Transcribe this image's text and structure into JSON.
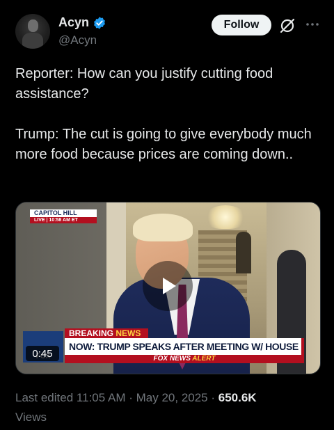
{
  "author": {
    "display_name": "Acyn",
    "handle": "@Acyn",
    "verified": true,
    "verified_color": "#1d9bf0"
  },
  "actions": {
    "follow_label": "Follow",
    "grok_icon": "grok-icon",
    "more_icon": "more-icon"
  },
  "tweet": {
    "text": "Reporter: How can you justify cutting food assistance?\n\nTrump: The cut is going to give everybody much more food because prices are coming down.."
  },
  "media": {
    "duration": "0:45",
    "location_bug": "CAPITOL HILL",
    "live_label": "LIVE",
    "live_time": "10:58 AM ET",
    "breaking_label": "BREAKING",
    "breaking_news": "NEWS",
    "headline": "NOW: TRUMP SPEAKS AFTER MEETING W/ HOUSE GOP",
    "network_logo": "FOX",
    "alert_prefix": "FOX NEWS",
    "alert_suffix": "ALERT",
    "play_icon": "play-icon"
  },
  "meta": {
    "edited_label": "Last edited",
    "time": "11:05 AM",
    "date": "May 20, 2025",
    "views_count": "650.6K",
    "views_label": "Views"
  }
}
